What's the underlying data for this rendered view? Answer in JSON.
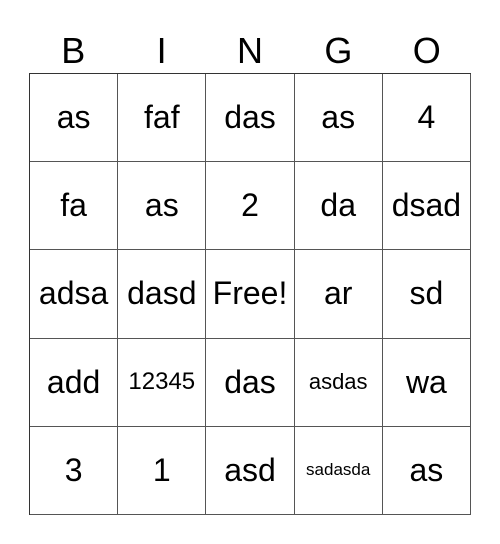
{
  "header": [
    "B",
    "I",
    "N",
    "G",
    "O"
  ],
  "rows": [
    [
      "as",
      "faf",
      "das",
      "as",
      "4"
    ],
    [
      "fa",
      "as",
      "2",
      "da",
      "dsad"
    ],
    [
      "adsa",
      "dasd",
      "Free!",
      "ar",
      "sd"
    ],
    [
      "add",
      "12345",
      "das",
      "asdas",
      "wa"
    ],
    [
      "3",
      "1",
      "asd",
      "sadasda",
      "as"
    ]
  ],
  "free_space": {
    "row": 2,
    "col": 2,
    "label": "Free!"
  }
}
